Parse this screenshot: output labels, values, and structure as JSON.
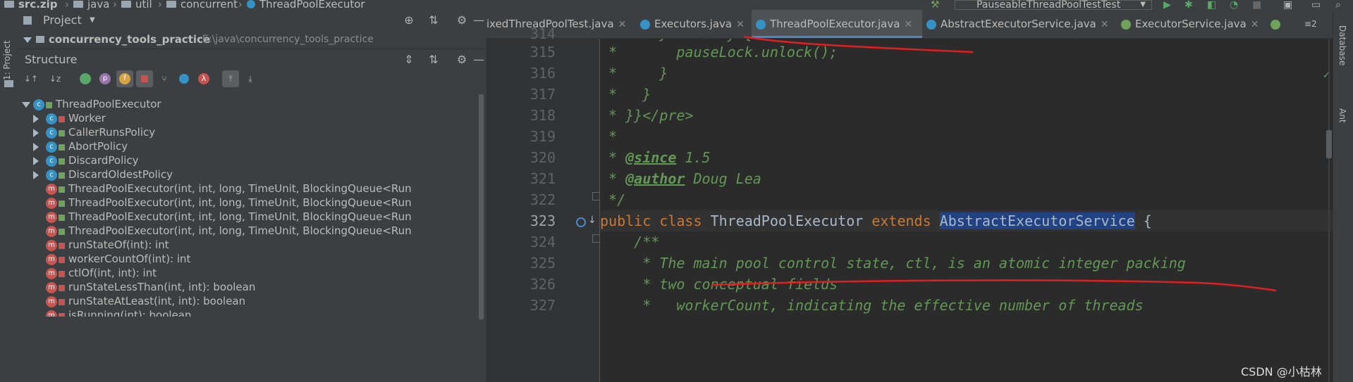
{
  "breadcrumb": {
    "items": [
      "src.zip",
      "java",
      "util",
      "concurrent",
      "ThreadPoolExecutor"
    ]
  },
  "toolbar": {
    "run_config": "PauseableThreadPoolTestTest",
    "icons": [
      "hammer-icon",
      "run-icon",
      "debug-icon",
      "coverage-icon",
      "profile-icon",
      "stop-icon",
      "frame-icon",
      "window-icon",
      "search-icon"
    ]
  },
  "left_strip": {
    "project_tab": "1: Project"
  },
  "project_panel": {
    "title": "Project",
    "root_name": "concurrency_tools_practice",
    "root_path": "E:\\java\\concurrency_tools_practice"
  },
  "structure_panel": {
    "title": "Structure",
    "tools": [
      "sort-visibility-icon",
      "sort-alpha-icon",
      "class-filter-icon",
      "property-icon",
      "field-icon",
      "non-public-icon",
      "inherited-icon",
      "anonymous-icon",
      "lambda-icon",
      "autoscroll-to-source-icon",
      "autoscroll-from-source-icon"
    ],
    "root": "ThreadPoolExecutor",
    "nested_classes": [
      "Worker",
      "CallerRunsPolicy",
      "AbortPolicy",
      "DiscardPolicy",
      "DiscardOldestPolicy"
    ],
    "members": [
      "ThreadPoolExecutor(int, int, long, TimeUnit, BlockingQueue<Runnable>)",
      "ThreadPoolExecutor(int, int, long, TimeUnit, BlockingQueue<Runnable>, Threa",
      "ThreadPoolExecutor(int, int, long, TimeUnit, BlockingQueue<Runnable>, Reject",
      "ThreadPoolExecutor(int, int, long, TimeUnit, BlockingQueue<Runnable>, Threa",
      "runStateOf(int): int",
      "workerCountOf(int): int",
      "ctlOf(int, int): int",
      "runStateLessThan(int, int): boolean",
      "runStateAtLeast(int, int): boolean",
      "isRunning(int): boolean"
    ]
  },
  "editor_tabs": [
    {
      "label": "ixedThreadPoolTest.java",
      "active": false
    },
    {
      "label": "Executors.java",
      "active": false
    },
    {
      "label": "ThreadPoolExecutor.java",
      "active": true
    },
    {
      "label": "AbstractExecutorService.java",
      "active": false
    },
    {
      "label": "ExecutorService.java",
      "active": false
    }
  ],
  "tab_overflow": "≡2",
  "right_strip": {
    "tabs": [
      "Database",
      "Ant"
    ]
  },
  "code": {
    "partial_line": "314",
    "lines": [
      {
        "no": "315",
        "text": " *       pauseLock.unlock();"
      },
      {
        "no": "316",
        "text": " *     }"
      },
      {
        "no": "317",
        "text": " *   }"
      },
      {
        "no": "318",
        "text": " * }}</pre>"
      },
      {
        "no": "319",
        "text": " *"
      },
      {
        "no": "320",
        "tag": "@since",
        "text": " 1.5"
      },
      {
        "no": "321",
        "tag": "@author",
        "text": " Doug Lea"
      },
      {
        "no": "322",
        "text": " */"
      },
      {
        "no": "323",
        "kw1": "public class",
        "name": " ThreadPoolExecutor ",
        "kw2": "extends",
        "sel": "AbstractExecutorService",
        "tail": " {"
      },
      {
        "no": "324",
        "text": "    /**"
      },
      {
        "no": "325",
        "text": "     * The main pool control state, ctl, is an atomic integer packing"
      },
      {
        "no": "326",
        "text": "     * two conceptual fields"
      },
      {
        "no": "327",
        "text": "     *   workerCount, indicating the effective number of threads"
      }
    ]
  },
  "colors": {
    "annotation_red": "#e02020",
    "selection": "#214283",
    "keyword": "#cc7832",
    "doc_comment": "#629755"
  },
  "watermark": "CSDN @小枯林"
}
